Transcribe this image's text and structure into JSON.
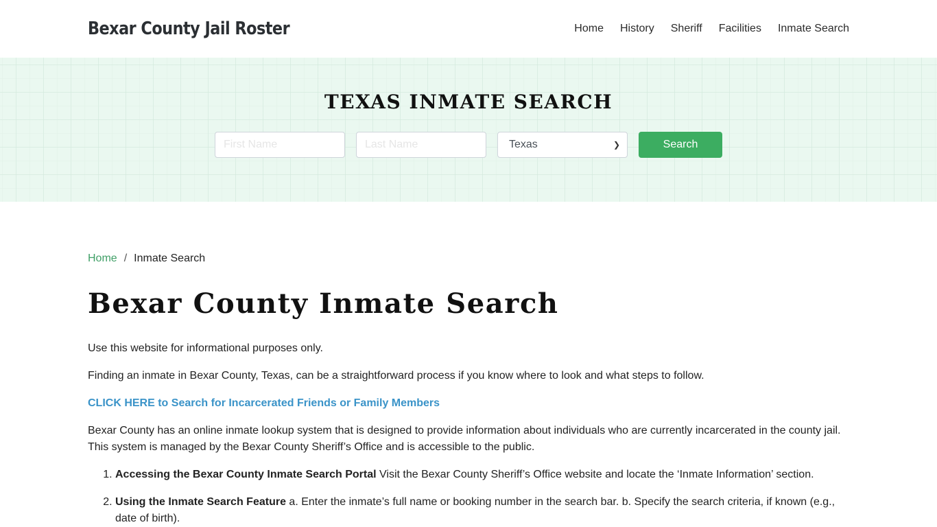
{
  "header": {
    "brand": "Bexar County Jail Roster",
    "nav": [
      {
        "label": "Home"
      },
      {
        "label": "History"
      },
      {
        "label": "Sheriff"
      },
      {
        "label": "Facilities"
      },
      {
        "label": "Inmate Search"
      }
    ]
  },
  "hero": {
    "title": "TEXAS INMATE SEARCH",
    "first_name_placeholder": "First Name",
    "last_name_placeholder": "Last Name",
    "first_name_value": "",
    "last_name_value": "",
    "state_selected": "Texas",
    "search_label": "Search",
    "accent_color": "#3cad61"
  },
  "breadcrumb": {
    "home": "Home",
    "separator": "/",
    "current": "Inmate Search"
  },
  "main": {
    "title": "Bexar County Inmate Search",
    "paragraphs": [
      "Use this website for informational purposes only.",
      "Finding an inmate in Bexar County, Texas, can be a straightforward process if you know where to look and what steps to follow."
    ],
    "cta_link": "CLICK HERE to Search for Incarcerated Friends or Family Members",
    "intro": "Bexar County has an online inmate lookup system that is designed to provide information about individuals who are currently incarcerated in the county jail. This system is managed by the Bexar County Sheriff’s Office and is accessible to the public.",
    "steps": [
      {
        "bold": "Accessing the Bexar County Inmate Search Portal",
        "text": " Visit the Bexar County Sheriff’s Office website and locate the ‘Inmate Information’ section."
      },
      {
        "bold": "Using the Inmate Search Feature",
        "text": " a. Enter the inmate’s full name or booking number in the search bar. b. Specify the search criteria, if known (e.g., date of birth)."
      }
    ]
  }
}
